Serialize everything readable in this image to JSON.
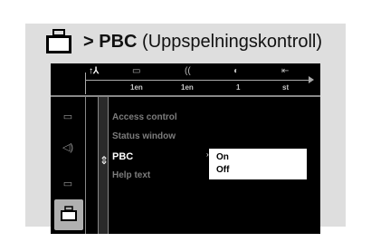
{
  "title": {
    "arrow": ">",
    "name": "PBC",
    "subtitle": "(Uppspelningskontroll)"
  },
  "topbar": {
    "icons": [
      "tools-icon",
      "subtitle-icon",
      "audio-icon",
      "angle-icon",
      "display-icon"
    ],
    "glyphs": [
      "↑⅄",
      "▭",
      "((",
      "◐",
      "⇤"
    ],
    "values": [
      "1en",
      "1en",
      "1",
      "st"
    ]
  },
  "sidebar": {
    "items": [
      "general-icon",
      "audio-icon",
      "subtitle-icon",
      "lock-icon"
    ],
    "glyphs": [
      "▭",
      "◁)",
      "▭",
      "🗀"
    ]
  },
  "menu": {
    "items": [
      "Access control",
      "Status window",
      "PBC",
      "Help text"
    ],
    "active": "PBC"
  },
  "popup": {
    "options": [
      "On",
      "Off"
    ],
    "selected": "On"
  },
  "colors": {
    "background": "#dedede",
    "screen": "#000000",
    "active_text": "#ffffff",
    "inactive_text": "#7c7c7c",
    "popup": "#ffffff"
  }
}
